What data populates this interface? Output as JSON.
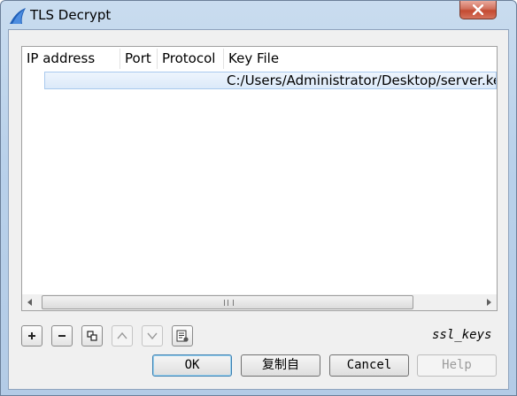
{
  "window": {
    "title": "TLS Decrypt"
  },
  "table": {
    "columns": [
      "IP address",
      "Port",
      "Protocol",
      "Key File"
    ],
    "rows": [
      {
        "ip": "",
        "port": "",
        "protocol": "",
        "key_file": "C:/Users/Administrator/Desktop/server.key"
      }
    ]
  },
  "toolbar": {
    "icons": [
      "plus-icon",
      "minus-icon",
      "copy-icon",
      "move-up-icon",
      "move-down-icon",
      "clear-icon"
    ],
    "label": "ssl_keys"
  },
  "buttons": {
    "ok": "OK",
    "copy_from": "复制自",
    "cancel": "Cancel",
    "help": "Help"
  },
  "colors": {
    "accent": "#3c7fb1",
    "selection": "#dbe9f9",
    "close": "#c44a31"
  }
}
